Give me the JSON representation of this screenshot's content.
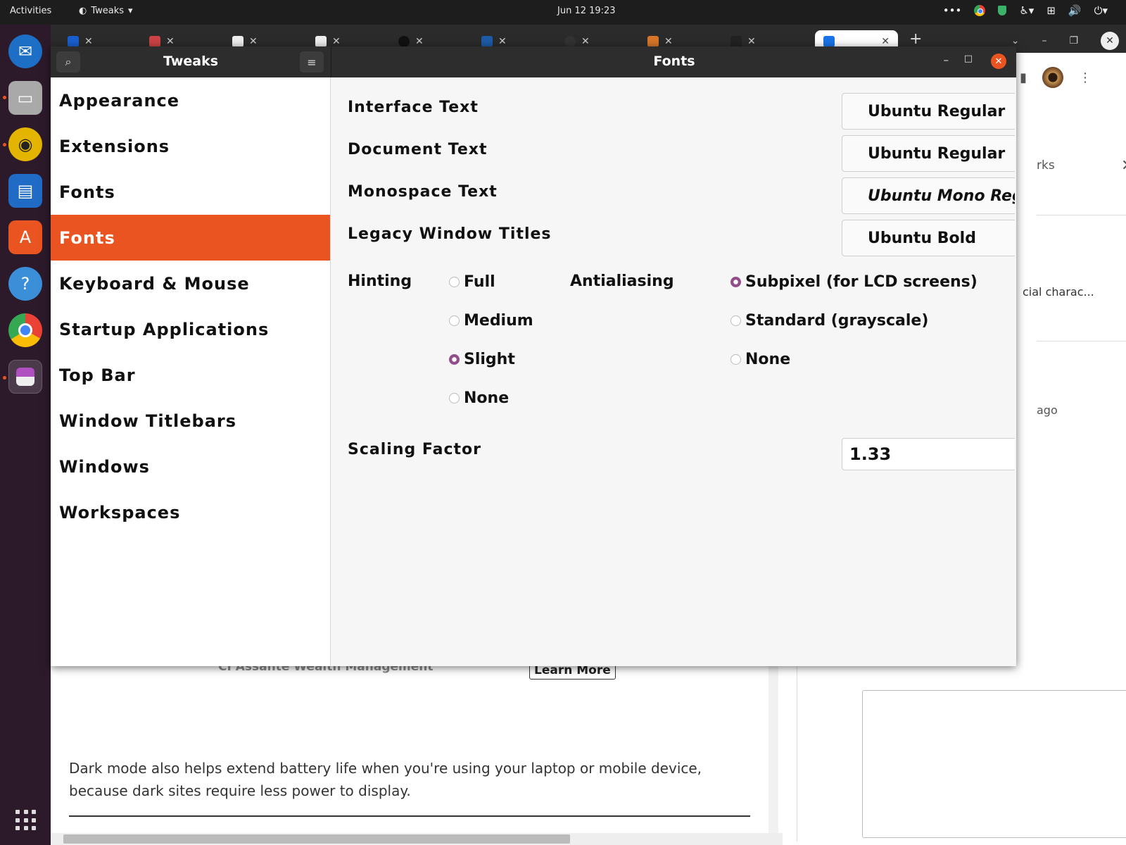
{
  "topbar": {
    "activities": "Activities",
    "app_menu": "Tweaks",
    "clock": "Jun 12  19:23"
  },
  "dock": {
    "items": [
      "thunderbird",
      "files",
      "rhythmbox",
      "writer",
      "app-center",
      "help",
      "chrome",
      "tweaks"
    ]
  },
  "browser": {
    "tabs": [
      {
        "icon": "settings-icon"
      },
      {
        "icon": "briefcase-icon"
      },
      {
        "icon": "wikipedia-icon"
      },
      {
        "icon": "wikipedia-icon"
      },
      {
        "icon": "github-icon"
      },
      {
        "icon": "translate-icon"
      },
      {
        "icon": "circle-icon"
      },
      {
        "icon": "fox-icon"
      },
      {
        "icon": "game-icon"
      },
      {
        "icon": "page-icon"
      }
    ],
    "panel_fragment_1": "rks",
    "panel_fragment_2": "cial charac...",
    "panel_fragment_3": "ago",
    "ad_text": "CI Assante Wealth Management",
    "learn_more": "Learn More",
    "article_text": "Dark mode also helps extend battery life when you're using your laptop or mobile device, because dark sites require less power to display."
  },
  "tweaks": {
    "app_title": "Tweaks",
    "page_title": "Fonts",
    "sidebar": [
      "Appearance",
      "Extensions",
      "Fonts",
      "Fonts",
      "Keyboard & Mouse",
      "Startup Applications",
      "Top Bar",
      "Window Titlebars",
      "Windows",
      "Workspaces"
    ],
    "selected_index": 3,
    "fonts": {
      "interface_label": "Interface Text",
      "interface_value": "Ubuntu Regular",
      "document_label": "Document Text",
      "document_value": "Ubuntu Regular",
      "monospace_label": "Monospace Text",
      "monospace_value": "Ubuntu Mono Regular",
      "legacy_label": "Legacy Window Titles",
      "legacy_value": "Ubuntu Bold"
    },
    "hinting": {
      "label": "Hinting",
      "options": [
        {
          "label": "Full",
          "selected": false
        },
        {
          "label": "Medium",
          "selected": false
        },
        {
          "label": "Slight",
          "selected": true
        },
        {
          "label": "None",
          "selected": false
        }
      ]
    },
    "antialiasing": {
      "label": "Antialiasing",
      "options": [
        {
          "label": "Subpixel (for LCD screens)",
          "selected": true
        },
        {
          "label": "Standard (grayscale)",
          "selected": false
        },
        {
          "label": "None",
          "selected": false
        }
      ]
    },
    "scaling": {
      "label": "Scaling Factor",
      "value": "1.33"
    }
  },
  "colors": {
    "accent": "#e95420",
    "radio": "#924d8b",
    "dock_bg": "#2c1a2b",
    "headerbar": "#2d2d2d"
  }
}
